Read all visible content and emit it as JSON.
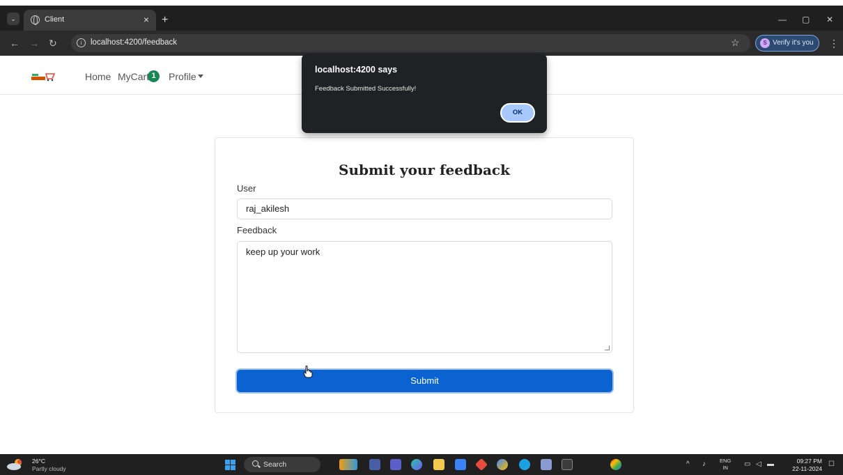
{
  "browser": {
    "tab_title": "Client",
    "tab_close": "×",
    "new_tab": "+",
    "url": "localhost:4200/feedback",
    "verify_label": "Verify it's you",
    "window": {
      "minimize": "—",
      "restore": "▢",
      "close": "✕"
    }
  },
  "navbar": {
    "links": {
      "home": "Home",
      "mycart": "MyCart",
      "profile": "Profile"
    },
    "cart_count": "1"
  },
  "form": {
    "title": "Submit your feedback",
    "user_label": "User",
    "user_value": "raj_akilesh",
    "feedback_label": "Feedback",
    "feedback_value": "keep up your work",
    "submit_label": "Submit"
  },
  "dialog": {
    "title": "localhost:4200 says",
    "message": "Feedback Submitted Successfully!",
    "ok_label": "OK"
  },
  "taskbar": {
    "weather_temp": "26°C",
    "weather_desc": "Partly cloudy",
    "search_label": "Search",
    "lang_top": "ENG",
    "lang_bottom": "IN",
    "time": "09:27 PM",
    "date": "22-11-2024"
  },
  "colors": {
    "primary_button": "#0a63d1",
    "cart_badge": "#198754",
    "dialog_bg": "#202124",
    "ok_button": "#a8c7fa"
  }
}
